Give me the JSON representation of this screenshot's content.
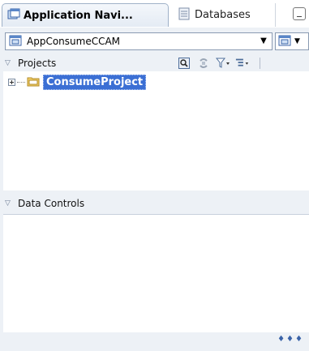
{
  "tabs": [
    {
      "label": "Application Navi...",
      "active": true,
      "icon": "application-navigator-icon"
    },
    {
      "label": "Databases",
      "active": false,
      "icon": "databases-icon"
    }
  ],
  "application_selector": {
    "value": "AppConsumeCCAM",
    "icon": "application-icon"
  },
  "projects_section": {
    "title": "Projects",
    "toolbar": [
      "search-icon",
      "refresh-icon",
      "filter-icon",
      "sort-icon"
    ]
  },
  "tree": {
    "nodes": [
      {
        "label": "ConsumeProject",
        "expanded": false,
        "selected": true,
        "icon": "folder-icon"
      }
    ]
  },
  "data_controls_section": {
    "title": "Data Controls"
  },
  "colors": {
    "selection": "#3b6fd4",
    "panel_background": "#edf1f6"
  }
}
